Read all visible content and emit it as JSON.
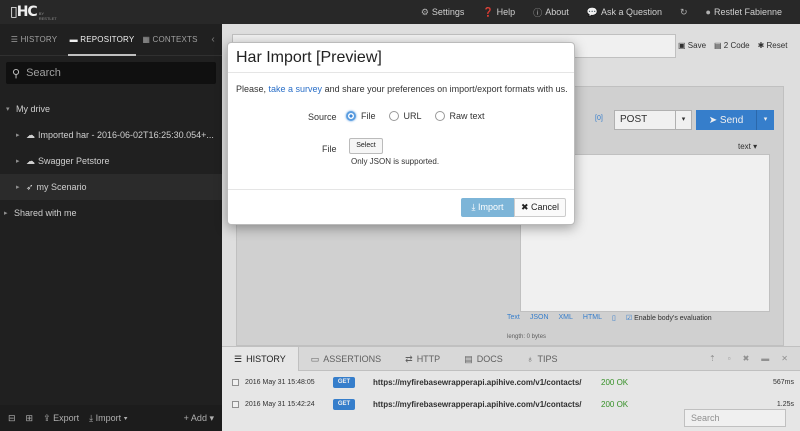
{
  "topbar": {
    "logo_text": "HC",
    "logo_sub": "BY RESTLET",
    "nav": [
      {
        "icon": "gear-icon",
        "glyph": "⚙",
        "label": "Settings"
      },
      {
        "icon": "help-icon",
        "glyph": "❓",
        "label": "Help"
      },
      {
        "icon": "info-icon",
        "glyph": "ⓘ",
        "label": "About"
      },
      {
        "icon": "chat-icon",
        "glyph": "💬",
        "label": "Ask a Question"
      },
      {
        "icon": "refresh-icon",
        "glyph": "↻",
        "label": ""
      },
      {
        "icon": "avatar-icon",
        "glyph": "●",
        "label": "Restlet Fabienne"
      }
    ]
  },
  "sidebar": {
    "tabs": [
      {
        "label": "HISTORY"
      },
      {
        "label": "REPOSITORY"
      },
      {
        "label": "CONTEXTS"
      }
    ],
    "search_placeholder": "Search",
    "tree": {
      "my_drive": "My drive",
      "imported": "Imported har - 2016-06-02T16:25:30.054+...",
      "swagger": "Swagger Petstore",
      "scenario": "my Scenario",
      "shared": "Shared with me"
    },
    "bottom": {
      "export": "Export",
      "import": "Import",
      "add": "+ Add"
    }
  },
  "main": {
    "toolbar": {
      "save": "Save",
      "code": "2 Code",
      "reset": "Reset"
    },
    "bracket_label": "[0]",
    "method": "POST",
    "send": "Send",
    "body_mode": "text",
    "formats": [
      "Text",
      "JSON",
      "XML",
      "HTML"
    ],
    "enable_eval": "Enable body's evaluation",
    "length": "length: 0 bytes"
  },
  "history": {
    "tabs": [
      {
        "label": "HISTORY"
      },
      {
        "label": "ASSERTIONS"
      },
      {
        "label": "HTTP"
      },
      {
        "label": "DOCS"
      },
      {
        "label": "TIPS"
      }
    ],
    "rows": [
      {
        "date": "2016 May 31 15:48:05",
        "method": "GET",
        "url": "https://myfirebasewrapperapi.apihive.com/v1/contacts/",
        "status": "200 OK",
        "time": "567ms"
      },
      {
        "date": "2016 May 31 15:42:24",
        "method": "GET",
        "url": "https://myfirebasewrapperapi.apihive.com/v1/contacts/",
        "status": "200 OK",
        "time": "1.25s"
      }
    ],
    "search_placeholder": "Search"
  },
  "modal": {
    "title": "Har Import [Preview]",
    "intro_before": "Please, ",
    "intro_link": "take a survey",
    "intro_after": " and share your preferences on import/export formats with us.",
    "source_label": "Source",
    "options": [
      "File",
      "URL",
      "Raw text"
    ],
    "selected_option": "File",
    "file_label": "File",
    "select_button": "Select",
    "hint": "Only JSON is supported.",
    "import_button": "Import",
    "cancel_button": "Cancel"
  }
}
